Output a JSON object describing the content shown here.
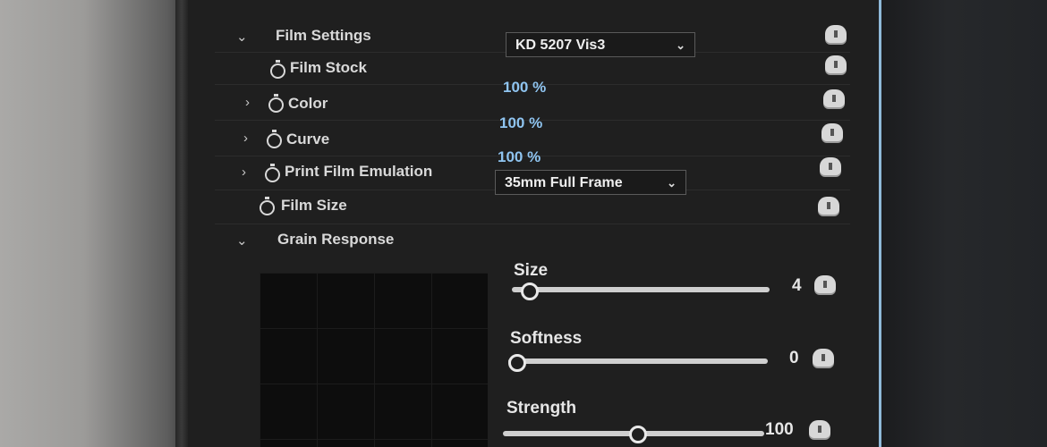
{
  "film_settings": {
    "section_label": "Film Settings",
    "film_stock": {
      "label": "Film Stock",
      "value": "KD 5207 Vis3"
    },
    "color": {
      "label": "Color",
      "value": "100 %"
    },
    "curve": {
      "label": "Curve",
      "value": "100 %"
    },
    "print_film_emulation": {
      "label": "Print Film Emulation",
      "value": "100 %"
    },
    "film_size": {
      "label": "Film Size",
      "value": "35mm Full Frame"
    }
  },
  "grain_response": {
    "section_label": "Grain Response",
    "size": {
      "label": "Size",
      "value": "4",
      "fraction": 0.0
    },
    "softness": {
      "label": "Softness",
      "value": "0",
      "fraction": 0.0
    },
    "strength": {
      "label": "Strength",
      "value": "100",
      "fraction": 0.5
    }
  },
  "colors": {
    "value_text": "#8fc4f0",
    "panel_bg": "#1f1f1f",
    "accent_edge": "#8fb9d8"
  }
}
